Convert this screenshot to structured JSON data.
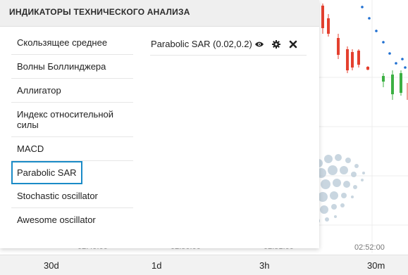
{
  "panel": {
    "title": "ИНДИКАТОРЫ ТЕХНИЧЕСКОГО АНАЛИЗА",
    "indicators": [
      {
        "label": "Скользящее среднее"
      },
      {
        "label": "Волны Боллинджера"
      },
      {
        "label": "Аллигатор"
      },
      {
        "label": "Индекс относительной силы"
      },
      {
        "label": "MACD"
      },
      {
        "label": "Parabolic SAR",
        "selected": true
      },
      {
        "label": "Stochastic oscillator"
      },
      {
        "label": "Awesome oscillator"
      }
    ],
    "active": [
      {
        "label": "Parabolic SAR (0.02,0.2)",
        "icons": [
          "eye-icon",
          "gear-icon",
          "close-icon"
        ]
      }
    ]
  },
  "chart": {
    "time_labels": [
      "02:49:00",
      "02:50:00",
      "02:51:00",
      "02:52:00"
    ]
  },
  "period_bar": {
    "items": [
      "30d",
      "1d",
      "3h",
      "30m"
    ]
  },
  "colors": {
    "accent": "#1a8bc7",
    "candle_up": "#3cb043",
    "candle_down": "#e4402f",
    "sar_dots": "#1f6fd1"
  }
}
